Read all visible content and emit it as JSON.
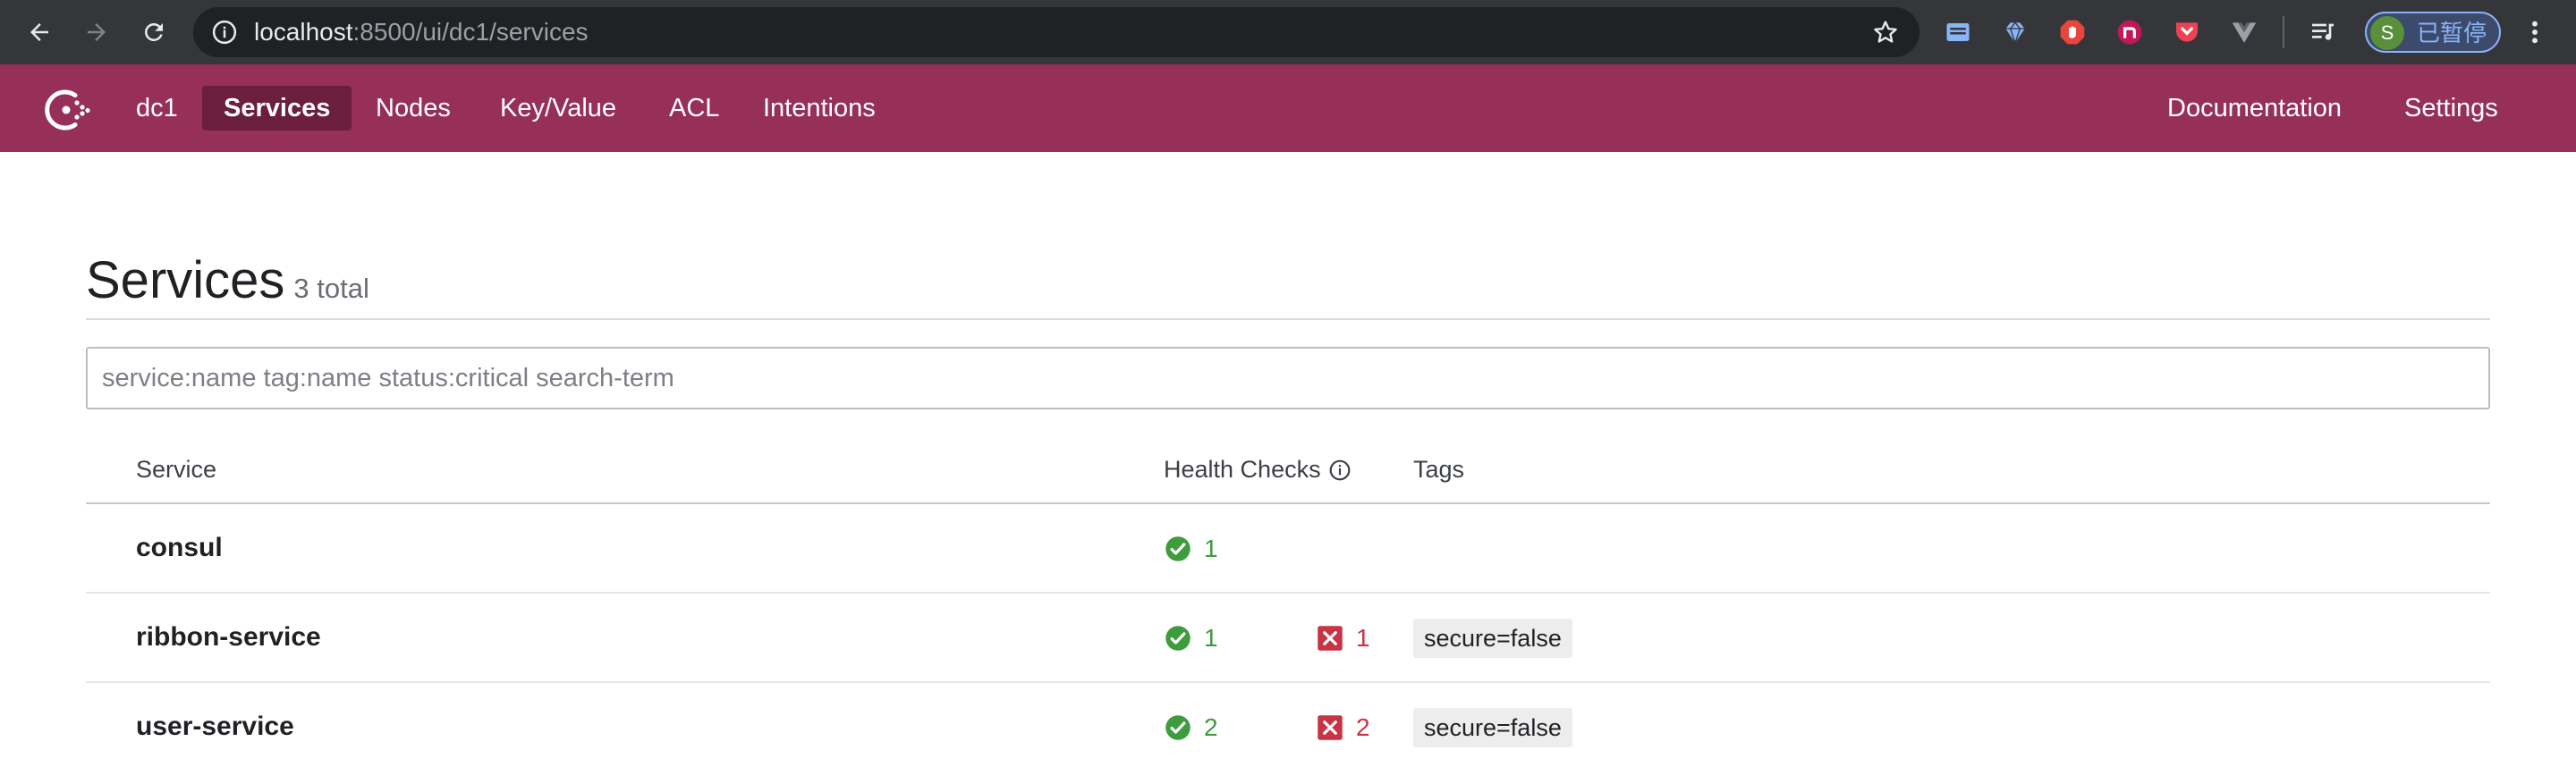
{
  "browser": {
    "url_host": "localhost",
    "url_path": ":8500/ui/dc1/services",
    "profile_initial": "S",
    "profile_label": "已暂停"
  },
  "nav": {
    "datacenter": "dc1",
    "items": [
      {
        "label": "Services",
        "active": true
      },
      {
        "label": "Nodes",
        "active": false
      },
      {
        "label": "Key/Value",
        "active": false
      },
      {
        "label": "ACL",
        "active": false
      },
      {
        "label": "Intentions",
        "active": false
      }
    ],
    "right": [
      {
        "label": "Documentation"
      },
      {
        "label": "Settings"
      }
    ]
  },
  "page": {
    "title": "Services",
    "count": "3 total"
  },
  "search": {
    "placeholder": "service:name tag:name status:critical search-term",
    "value": ""
  },
  "table": {
    "columns": {
      "service": "Service",
      "health": "Health Checks",
      "tags": "Tags"
    },
    "rows": [
      {
        "name": "consul",
        "passing": "1",
        "critical": "",
        "tag": ""
      },
      {
        "name": "ribbon-service",
        "passing": "1",
        "critical": "1",
        "tag": "secure=false"
      },
      {
        "name": "user-service",
        "passing": "2",
        "critical": "2",
        "tag": "secure=false"
      }
    ]
  },
  "colors": {
    "brand": "#962f5a",
    "brand_active": "#6b1e3e",
    "passing": "#3e9b3e",
    "critical": "#c73445"
  }
}
